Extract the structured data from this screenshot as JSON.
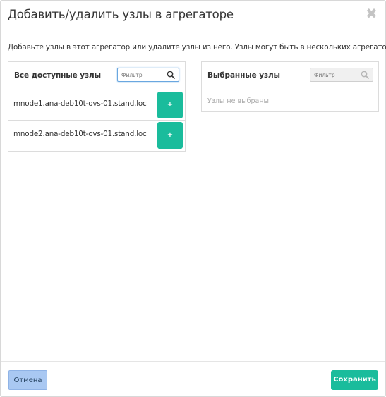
{
  "modal": {
    "title": "Добавить/удалить узлы в агрегаторе",
    "close_glyph": "✖",
    "help_text": "Добавьте узлы в этот агрегатор или удалите узлы из него. Узлы могут быть в нескольких агрегаторах."
  },
  "available": {
    "title": "Все доступные узлы",
    "filter_placeholder": "Фильтр",
    "filter_value": "",
    "items": [
      {
        "label": "mnode1.ana-deb10t-ovs-01.stand.loc",
        "add_label": "+"
      },
      {
        "label": "mnode2.ana-deb10t-ovs-01.stand.loc",
        "add_label": "+"
      }
    ]
  },
  "selected": {
    "title": "Выбранные узлы",
    "filter_placeholder": "Фильтр",
    "empty_text": "Узлы не выбраны."
  },
  "footer": {
    "cancel_label": "Отмена",
    "save_label": "Сохранить"
  },
  "colors": {
    "accent": "#1abc9c",
    "cancel_bg": "#a9c8f2"
  },
  "icons": {
    "close": "close-icon",
    "search": "search-icon"
  }
}
